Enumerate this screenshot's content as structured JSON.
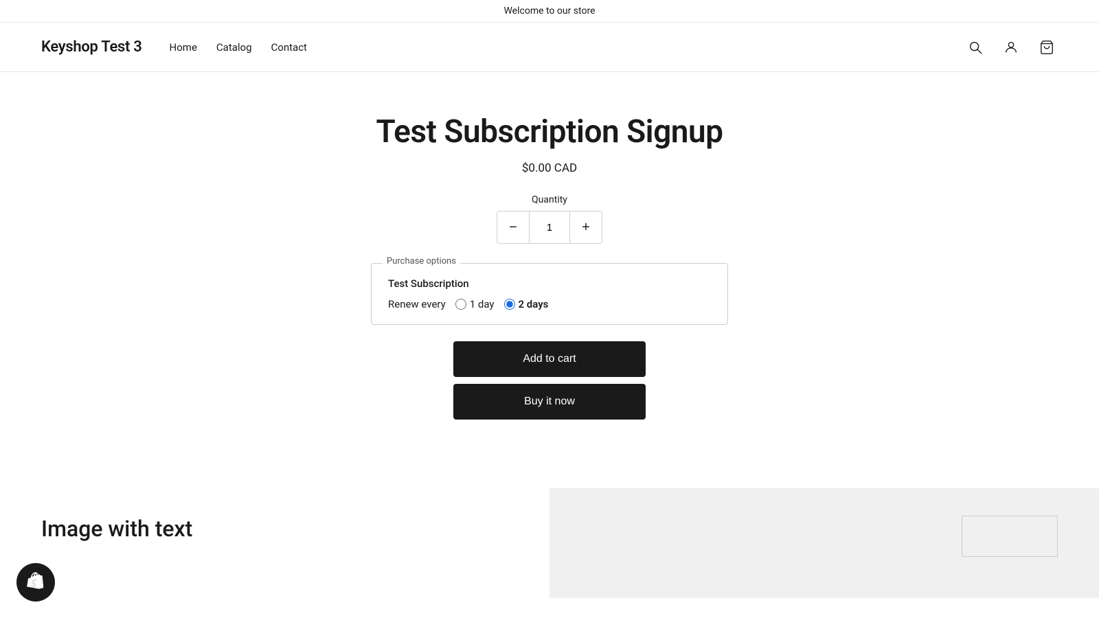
{
  "announcement": {
    "text": "Welcome to our store"
  },
  "header": {
    "store_name": "Keyshop Test 3",
    "nav": [
      {
        "label": "Home",
        "href": "#"
      },
      {
        "label": "Catalog",
        "href": "#"
      },
      {
        "label": "Contact",
        "href": "#"
      }
    ]
  },
  "product": {
    "title": "Test Subscription Signup",
    "price": "$0.00 CAD",
    "quantity_label": "Quantity",
    "quantity_value": "1",
    "purchase_options_legend": "Purchase options",
    "subscription_name": "Test Subscription",
    "renew_label": "Renew every",
    "renew_options": [
      {
        "label": "1 day",
        "value": "1day",
        "selected": false
      },
      {
        "label": "2 days",
        "value": "2days",
        "selected": true
      }
    ],
    "add_to_cart_label": "Add to cart",
    "buy_it_now_label": "Buy it now"
  },
  "bottom_section": {
    "image_with_text_title": "Image with text"
  },
  "icons": {
    "search": "search-icon",
    "account": "account-icon",
    "cart": "cart-icon",
    "shopify": "shopify-icon",
    "minus": "−",
    "plus": "+"
  }
}
